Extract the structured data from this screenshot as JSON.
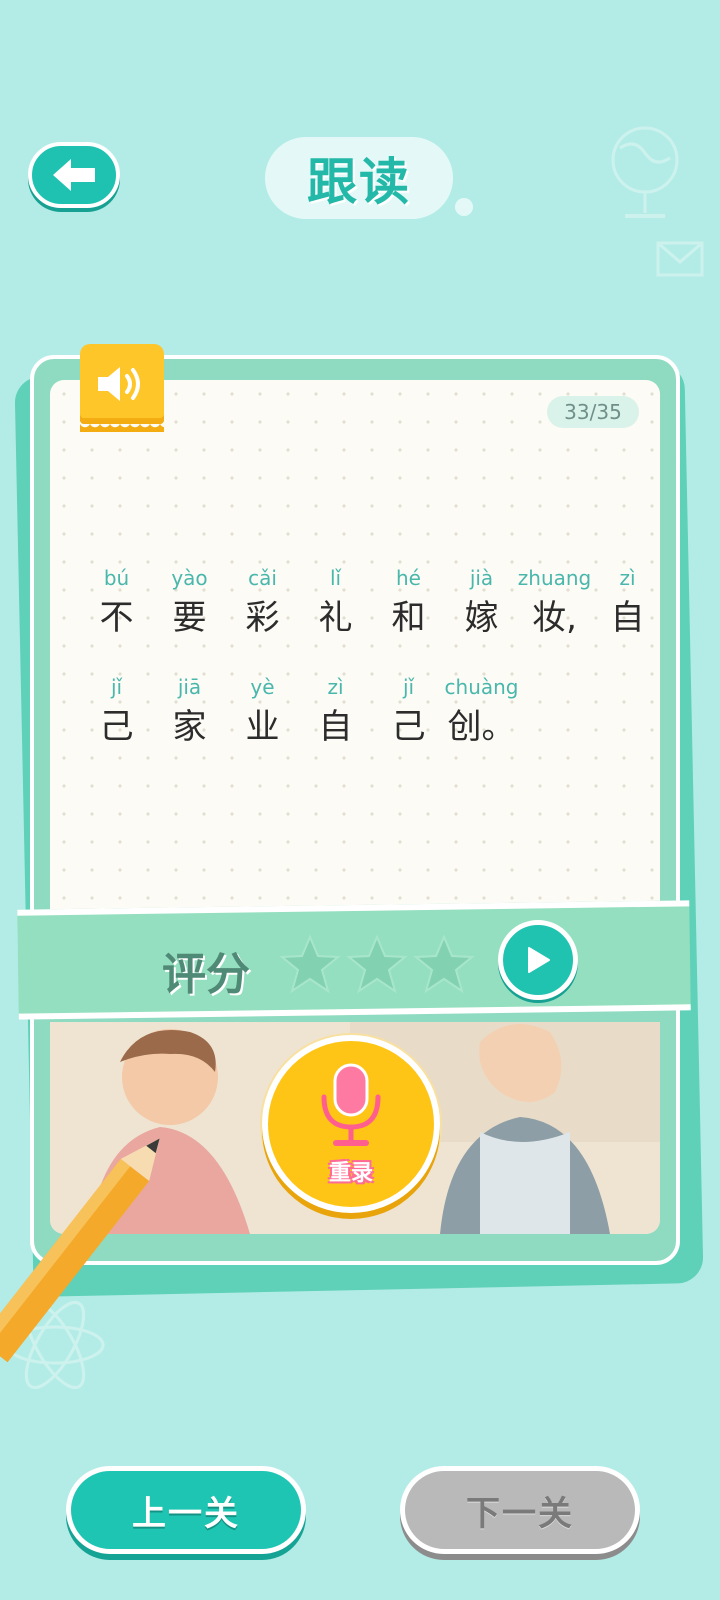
{
  "header": {
    "title": "跟读"
  },
  "card": {
    "counter": "33/35",
    "lines": [
      [
        {
          "py": "bú",
          "hz": "不"
        },
        {
          "py": "yào",
          "hz": "要"
        },
        {
          "py": "cǎi",
          "hz": "彩"
        },
        {
          "py": "lǐ",
          "hz": "礼"
        },
        {
          "py": "hé",
          "hz": "和"
        },
        {
          "py": "jià",
          "hz": "嫁"
        },
        {
          "py": "zhuang",
          "hz": "妆,"
        },
        {
          "py": "zì",
          "hz": "自"
        }
      ],
      [
        {
          "py": "jǐ",
          "hz": "己"
        },
        {
          "py": "jiā",
          "hz": "家"
        },
        {
          "py": "yè",
          "hz": "业"
        },
        {
          "py": "zì",
          "hz": "自"
        },
        {
          "py": "jǐ",
          "hz": "己"
        },
        {
          "py": "chuàng",
          "hz": "创。"
        }
      ]
    ]
  },
  "rating": {
    "label": "评分",
    "stars_earned": 0,
    "stars_total": 3
  },
  "record": {
    "label": "重录"
  },
  "nav": {
    "prev_label": "上一关",
    "next_label": "下一关"
  },
  "colors": {
    "accent": "#1fc5b3",
    "background": "#b3ece6",
    "mic": "#ffc516",
    "disabled": "#b9b9b9"
  }
}
